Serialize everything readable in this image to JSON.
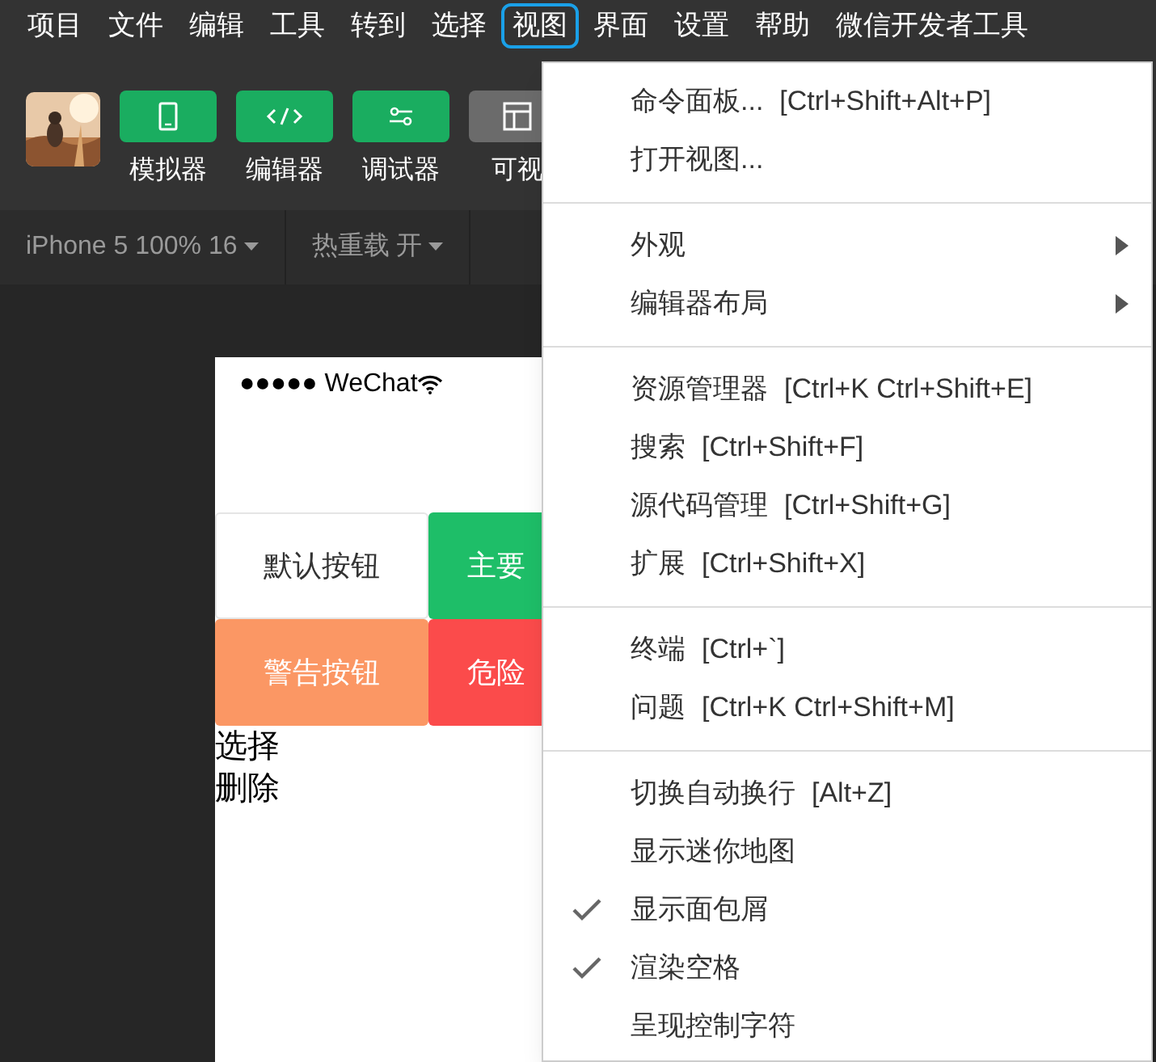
{
  "menubar": [
    {
      "label": "项目",
      "selected": false
    },
    {
      "label": "文件",
      "selected": false
    },
    {
      "label": "编辑",
      "selected": false
    },
    {
      "label": "工具",
      "selected": false
    },
    {
      "label": "转到",
      "selected": false
    },
    {
      "label": "选择",
      "selected": false
    },
    {
      "label": "视图",
      "selected": true
    },
    {
      "label": "界面",
      "selected": false
    },
    {
      "label": "设置",
      "selected": false
    },
    {
      "label": "帮助",
      "selected": false
    },
    {
      "label": "微信开发者工具",
      "selected": false
    }
  ],
  "toolbar": [
    {
      "label": "模拟器",
      "kind": "phone",
      "on": true
    },
    {
      "label": "编辑器",
      "kind": "code",
      "on": true
    },
    {
      "label": "调试器",
      "kind": "sliders",
      "on": true
    },
    {
      "label": "可视",
      "kind": "layout",
      "on": false
    }
  ],
  "subbar": [
    {
      "label": "iPhone 5 100% 16"
    },
    {
      "label": "热重载 开"
    }
  ],
  "simulator": {
    "status": "●●●●● WeChat",
    "buttons": [
      {
        "label": "默认按钮",
        "kind": "default"
      },
      {
        "label": "主要",
        "kind": "primary"
      },
      {
        "label": "警告按钮",
        "kind": "warn"
      },
      {
        "label": "危险",
        "kind": "danger"
      }
    ],
    "lines": [
      "选择",
      "删除"
    ]
  },
  "view_menu": [
    [
      {
        "label": "命令面板...",
        "shortcut": "[Ctrl+Shift+Alt+P]",
        "checked": false,
        "submenu": false
      },
      {
        "label": "打开视图...",
        "checked": false,
        "submenu": false
      }
    ],
    [
      {
        "label": "外观",
        "checked": false,
        "submenu": true
      },
      {
        "label": "编辑器布局",
        "checked": false,
        "submenu": true
      }
    ],
    [
      {
        "label": "资源管理器",
        "shortcut": "[Ctrl+K Ctrl+Shift+E]",
        "checked": false,
        "submenu": false
      },
      {
        "label": "搜索",
        "shortcut": "[Ctrl+Shift+F]",
        "checked": false,
        "submenu": false
      },
      {
        "label": "源代码管理",
        "shortcut": "[Ctrl+Shift+G]",
        "checked": false,
        "submenu": false
      },
      {
        "label": "扩展",
        "shortcut": "[Ctrl+Shift+X]",
        "checked": false,
        "submenu": false
      }
    ],
    [
      {
        "label": "终端",
        "shortcut": "[Ctrl+`]",
        "checked": false,
        "submenu": false
      },
      {
        "label": "问题",
        "shortcut": "[Ctrl+K Ctrl+Shift+M]",
        "checked": false,
        "submenu": false
      }
    ],
    [
      {
        "label": "切换自动换行",
        "shortcut": "[Alt+Z]",
        "checked": false,
        "submenu": false
      },
      {
        "label": "显示迷你地图",
        "checked": false,
        "submenu": false
      },
      {
        "label": "显示面包屑",
        "checked": true,
        "submenu": false
      },
      {
        "label": "渲染空格",
        "checked": true,
        "submenu": false
      },
      {
        "label": "呈现控制字符",
        "checked": false,
        "submenu": false
      }
    ]
  ]
}
